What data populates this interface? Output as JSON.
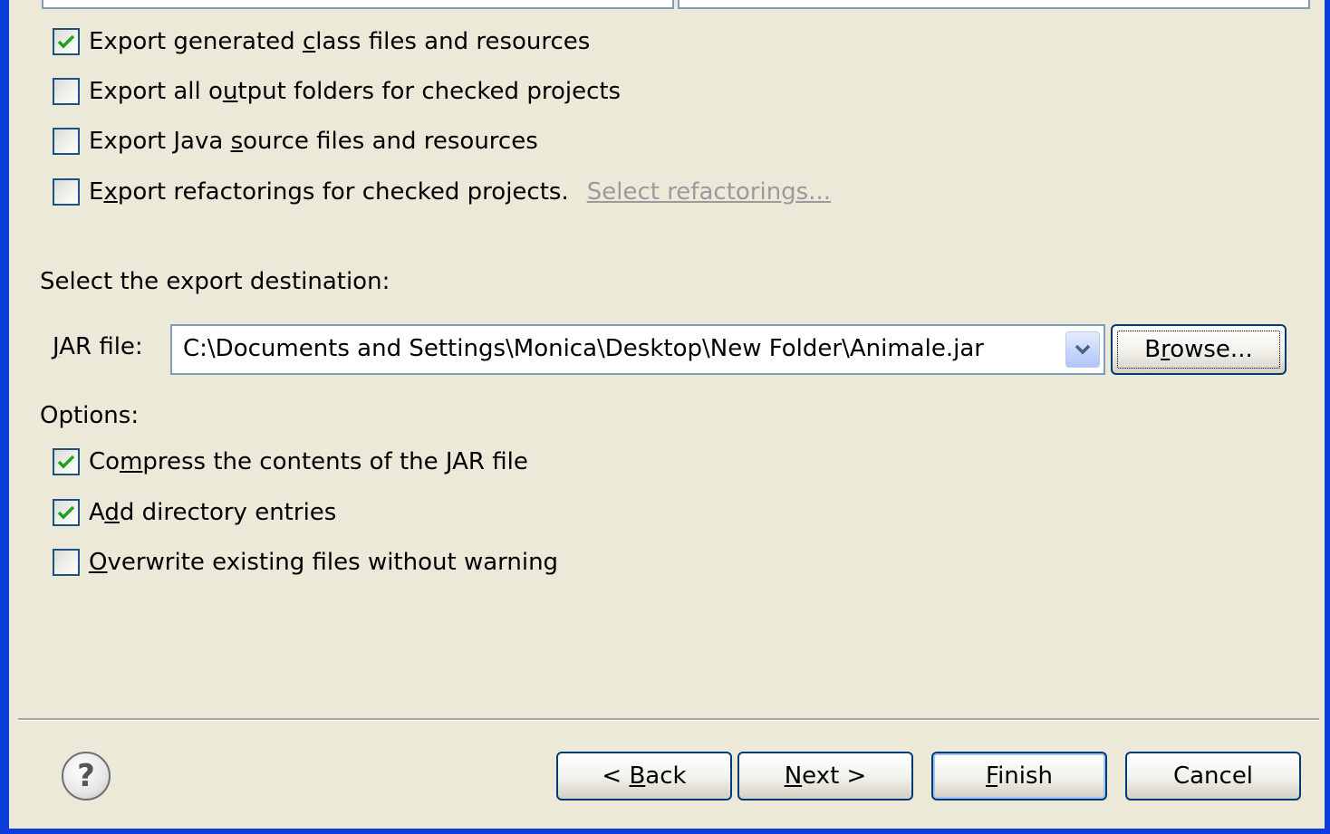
{
  "checkboxes_top": [
    {
      "pre": "Export generated ",
      "mn": "c",
      "post": "lass files and resources",
      "checked": true
    },
    {
      "pre": "Export all o",
      "mn": "u",
      "post": "tput folders for checked projects",
      "checked": false
    },
    {
      "pre": "Export Java ",
      "mn": "s",
      "post": "ource files and resources",
      "checked": false
    },
    {
      "pre": "E",
      "mn": "x",
      "post": "port refactorings for checked projects.",
      "checked": false
    }
  ],
  "select_refactorings_link": "Select refactorings...",
  "destination_label": "Select the export destination:",
  "jar_label": {
    "mn": "J",
    "post": "AR file:"
  },
  "jar_path": "C:\\Documents and Settings\\Monica\\Desktop\\New Folder\\Animale.jar",
  "browse_button": {
    "pre": "B",
    "mn": "r",
    "post": "owse..."
  },
  "options_label": "Options:",
  "options": [
    {
      "pre": "Co",
      "mn": "m",
      "post": "press the contents of the JAR file",
      "checked": true
    },
    {
      "pre": "A",
      "mn": "d",
      "post": "d directory entries",
      "checked": true
    },
    {
      "pre": "",
      "mn": "O",
      "post": "verwrite existing files without warning",
      "checked": false
    }
  ],
  "buttons": {
    "back": {
      "pre": "< ",
      "mn": "B",
      "post": "ack"
    },
    "next": {
      "pre": "",
      "mn": "N",
      "post": "ext >"
    },
    "finish": {
      "pre": "",
      "mn": "F",
      "post": "inish"
    },
    "cancel": "Cancel"
  },
  "help_icon_glyph": "?",
  "icons": [
    "checkmark-icon",
    "chevron-down-icon",
    "help-icon"
  ],
  "colors": {
    "window_border": "#0a3fd9",
    "background": "#ece9d8",
    "check_green": "#21a121"
  }
}
